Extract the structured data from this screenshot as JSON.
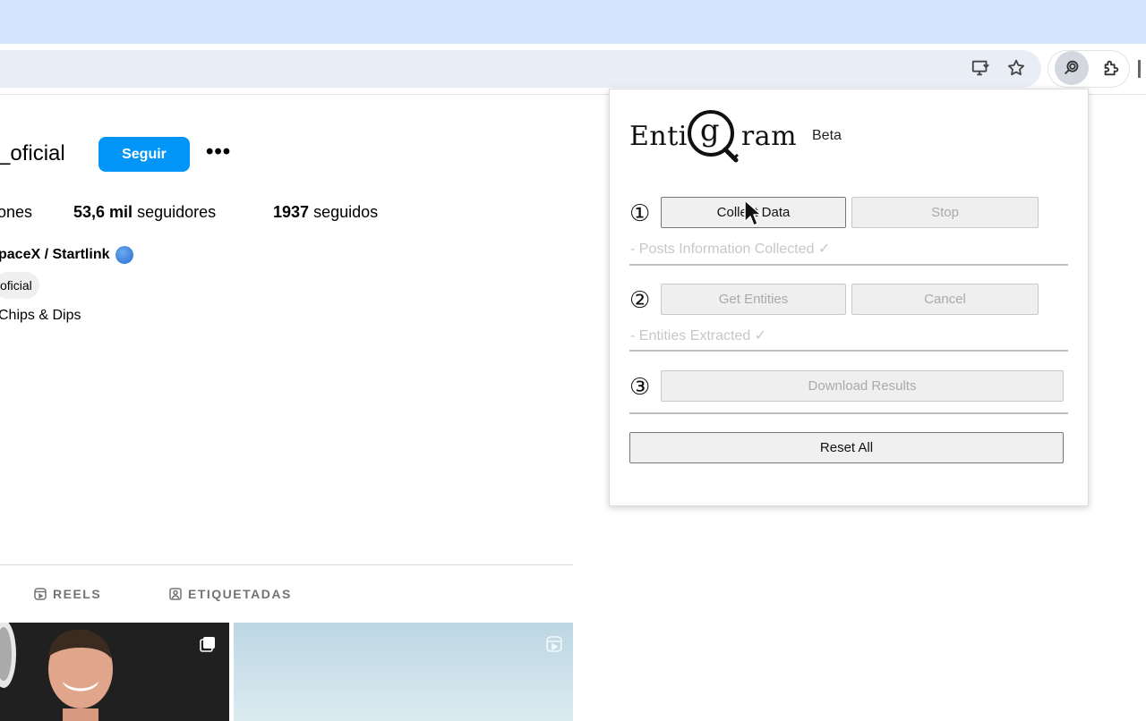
{
  "browser": {
    "toolbar_icons": [
      "install-app-icon",
      "bookmark-star-icon",
      "extension-magnifier-icon",
      "extensions-puzzle-icon"
    ]
  },
  "profile": {
    "username": "_oficial",
    "follow_label": "Seguir",
    "more_label": "•••",
    "stats": {
      "posts_label": "ones",
      "followers_count": "53,6 mil",
      "followers_label": "seguidores",
      "following_count": "1937",
      "following_label": "seguidos"
    },
    "bio_name": "paceX / Startlink",
    "bio_chip": "oficial",
    "bio_line": "Chips & Dips",
    "tabs": [
      {
        "label": "REELS",
        "icon": "reels-icon"
      },
      {
        "label": "ETIQUETADAS",
        "icon": "tagged-icon"
      }
    ]
  },
  "extension": {
    "logo_text_left": "Enti",
    "logo_letter": "g",
    "logo_text_right": "ram",
    "beta_label": "Beta",
    "steps": [
      {
        "number": "①",
        "primary_label": "Collect Data",
        "secondary_label": "Stop",
        "status": "- Posts Information Collected ✓"
      },
      {
        "number": "②",
        "primary_label": "Get Entities",
        "secondary_label": "Cancel",
        "status": "- Entities Extracted ✓"
      },
      {
        "number": "③",
        "primary_label": "Download Results"
      }
    ],
    "reset_label": "Reset All"
  },
  "colors": {
    "tabstrip": "#d3e3fd",
    "follow_button": "#0095f6",
    "disabled_text": "#aaaaaa",
    "status_text": "#c7c7c7"
  }
}
